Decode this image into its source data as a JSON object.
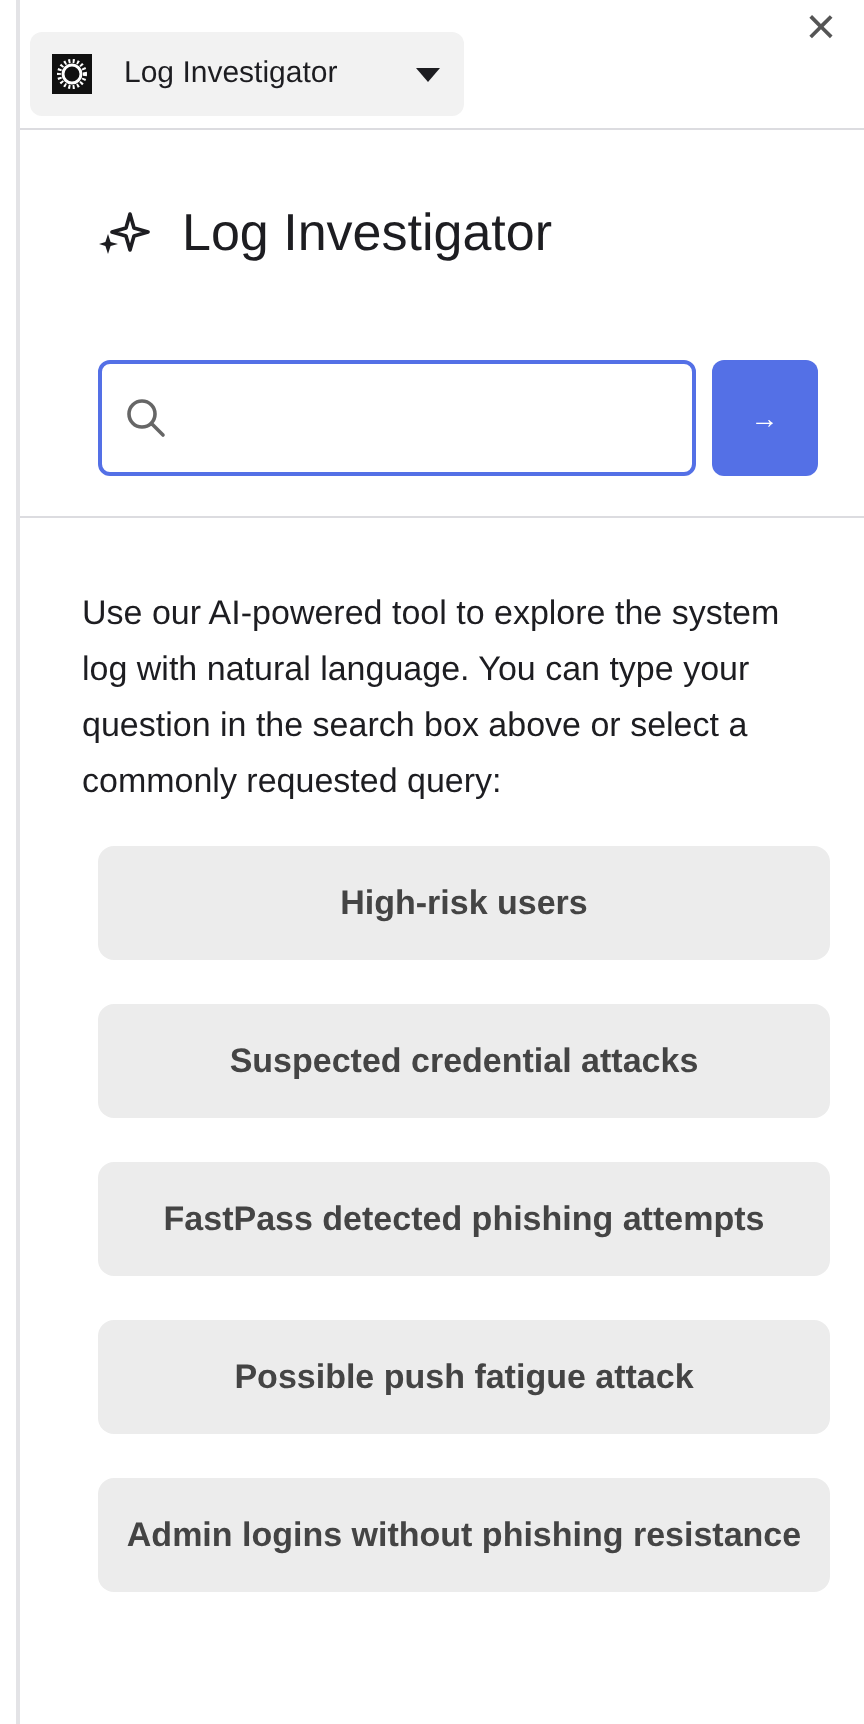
{
  "header": {
    "app_switcher": {
      "label": "Log Investigator"
    },
    "close": "×"
  },
  "title": "Log Investigator",
  "search": {
    "submit": "→"
  },
  "description": "Use our AI-powered tool to explore the system log with natural language. You can type your question in the search box above or select a commonly requested query:",
  "queries": [
    {
      "label": "High-risk users"
    },
    {
      "label": "Suspected credential attacks"
    },
    {
      "label": "FastPass detected phishing attempts"
    },
    {
      "label": "Possible push fatigue attack"
    },
    {
      "label": "Admin logins without phishing resistance"
    }
  ]
}
